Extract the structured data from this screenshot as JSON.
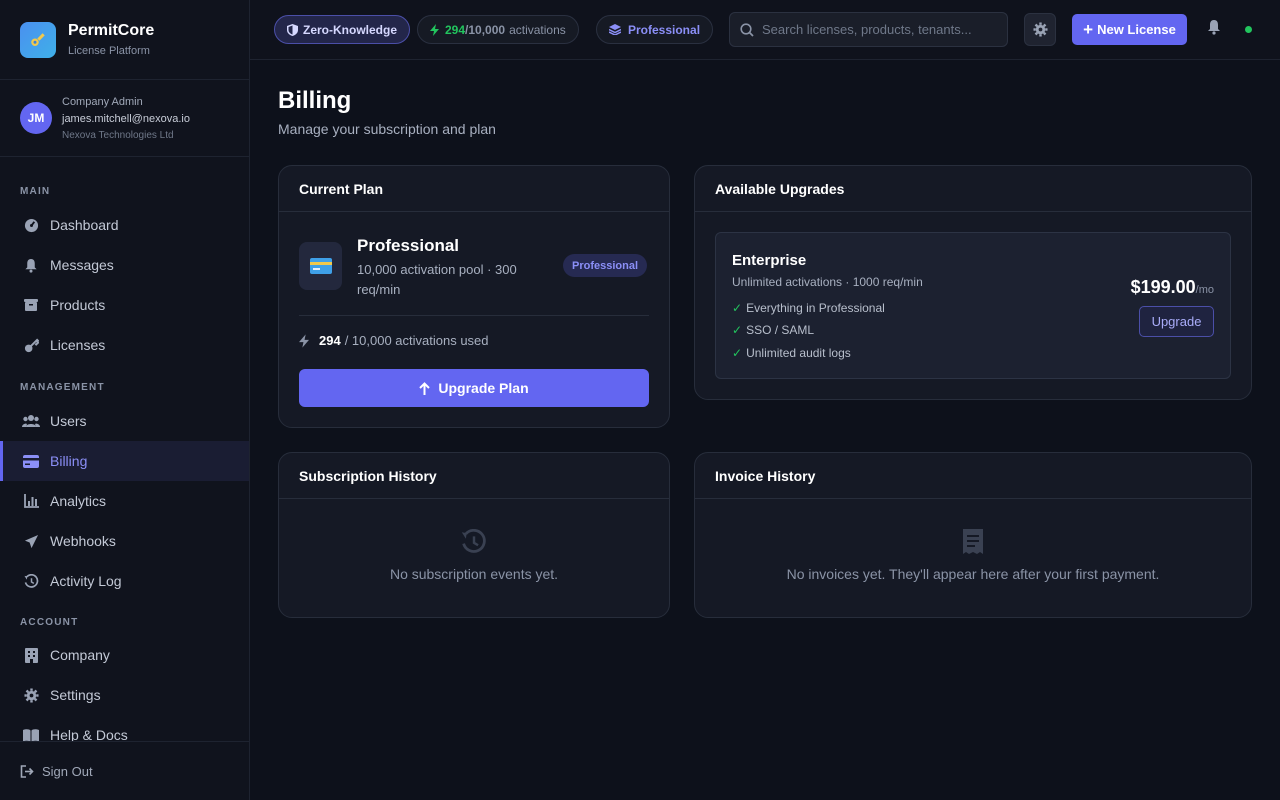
{
  "brand": {
    "name": "PermitCore",
    "subtitle": "License Platform"
  },
  "user": {
    "initials": "JM",
    "role": "Company Admin",
    "email": "james.mitchell@nexova.io",
    "company": "Nexova Technologies Ltd"
  },
  "sidebar": {
    "sections": [
      {
        "title": "MAIN",
        "items": [
          {
            "label": "Dashboard",
            "icon": "dashboard-icon"
          },
          {
            "label": "Messages",
            "icon": "bell-icon"
          },
          {
            "label": "Products",
            "icon": "box-icon"
          },
          {
            "label": "Licenses",
            "icon": "key-icon"
          }
        ]
      },
      {
        "title": "MANAGEMENT",
        "items": [
          {
            "label": "Users",
            "icon": "users-icon"
          },
          {
            "label": "Billing",
            "icon": "credit-card-icon",
            "active": true
          },
          {
            "label": "Analytics",
            "icon": "chart-icon"
          },
          {
            "label": "Webhooks",
            "icon": "send-icon"
          },
          {
            "label": "Activity Log",
            "icon": "history-icon"
          }
        ]
      },
      {
        "title": "ACCOUNT",
        "items": [
          {
            "label": "Company",
            "icon": "building-icon"
          },
          {
            "label": "Settings",
            "icon": "gear-icon"
          },
          {
            "label": "Help & Docs",
            "icon": "book-icon"
          }
        ]
      }
    ],
    "signout_label": "Sign Out"
  },
  "topbar": {
    "zk_label": "Zero-Knowledge",
    "activations_used": "294",
    "activations_total": "/10,000",
    "activations_suffix": "activations",
    "plan_label": "Professional",
    "search_placeholder": "Search licenses, products, tenants...",
    "new_license_label": "New License"
  },
  "page": {
    "title": "Billing",
    "subtitle": "Manage your subscription and plan"
  },
  "current_plan": {
    "header": "Current Plan",
    "name": "Professional",
    "description": "10,000 activation pool · 300 req/min",
    "badge": "Professional",
    "used": "294",
    "usage_rest": "/ 10,000 activations used",
    "upgrade_label": "Upgrade Plan"
  },
  "upgrades": {
    "header": "Available Upgrades",
    "plan": {
      "name": "Enterprise",
      "description": "Unlimited activations · 1000 req/min",
      "features": [
        "Everything in Professional",
        "SSO / SAML",
        "Unlimited audit logs"
      ],
      "price": "$199.00",
      "period": "/mo",
      "button": "Upgrade"
    }
  },
  "subscription_history": {
    "header": "Subscription History",
    "empty": "No subscription events yet."
  },
  "invoice_history": {
    "header": "Invoice History",
    "empty": "No invoices yet. They'll appear here after your first payment."
  },
  "colors": {
    "accent": "#6366f1",
    "success": "#22c55e",
    "background": "#0d111b"
  }
}
